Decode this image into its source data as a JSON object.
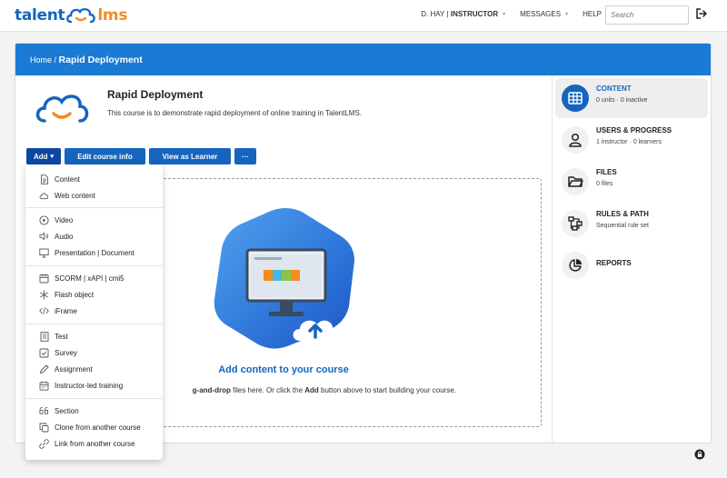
{
  "brand": {
    "part1": "talent",
    "part2": "lms"
  },
  "topnav": {
    "user_name": "D. HAY",
    "separator": " | ",
    "user_role": "INSTRUCTOR",
    "messages": "MESSAGES",
    "help": "HELP",
    "search_placeholder": "Search"
  },
  "breadcrumb": {
    "home": "Home",
    "sep": " / ",
    "current": "Rapid Deployment"
  },
  "course": {
    "title": "Rapid Deployment",
    "description": "This course is to demonstrate rapid deployment of online training in TalentLMS."
  },
  "buttons": {
    "add": "Add",
    "add_caret": "▾",
    "edit": "Edit course info",
    "view_as_learner": "View as Learner",
    "more": "···"
  },
  "dropzone": {
    "title": "Add content to your course",
    "text_prefix": "g-and-drop",
    "text_mid": " files here. Or click the ",
    "text_bold": "Add",
    "text_suffix": " button above to start building your course."
  },
  "sidebar": {
    "items": [
      {
        "title": "CONTENT",
        "subtitle": "0 units · 0 inactive",
        "icon": "grid-icon"
      },
      {
        "title": "USERS & PROGRESS",
        "subtitle": "1 instructor · 0 learners",
        "icon": "user-icon"
      },
      {
        "title": "FILES",
        "subtitle": "0 files",
        "icon": "folder-icon"
      },
      {
        "title": "RULES & PATH",
        "subtitle": "Sequential rule set",
        "icon": "path-icon"
      },
      {
        "title": "REPORTS",
        "subtitle": "",
        "icon": "pie-chart-icon"
      }
    ]
  },
  "add_menu": {
    "items": [
      {
        "label": "Content",
        "icon": "document-icon"
      },
      {
        "label": "Web content",
        "icon": "cloud-icon"
      },
      {
        "label": "Video",
        "icon": "play-icon"
      },
      {
        "label": "Audio",
        "icon": "speaker-icon"
      },
      {
        "label": "Presentation | Document",
        "icon": "presentation-icon"
      },
      {
        "label": "SCORM | xAPI | cmi5",
        "icon": "package-icon"
      },
      {
        "label": "Flash object",
        "icon": "asterisk-icon"
      },
      {
        "label": "iFrame",
        "icon": "code-icon"
      },
      {
        "label": "Test",
        "icon": "test-icon"
      },
      {
        "label": "Survey",
        "icon": "checkbox-icon"
      },
      {
        "label": "Assignment",
        "icon": "pencil-icon"
      },
      {
        "label": "Instructor-led training",
        "icon": "calendar-icon"
      },
      {
        "label": "Section",
        "icon": "quote-icon"
      },
      {
        "label": "Clone from another course",
        "icon": "clone-icon"
      },
      {
        "label": "Link from another course",
        "icon": "link-icon"
      }
    ]
  },
  "colors": {
    "brand_blue": "#1565c0",
    "brand_orange": "#f58c1f",
    "header_blue": "#1a7ad4"
  }
}
